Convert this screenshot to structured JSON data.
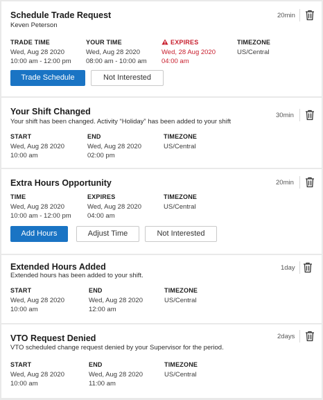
{
  "cards": [
    {
      "title": "Schedule Trade Request",
      "subtitle": "Keven Peterson",
      "time_ago": "20min",
      "columns": [
        {
          "label": "TRADE TIME",
          "line1": "Wed, Aug 28 2020",
          "line2": "10:00 am - 12:00 pm"
        },
        {
          "label": "YOUR TIME",
          "line1": "Wed, Aug 28 2020",
          "line2": "08:00 am - 10:00 am"
        },
        {
          "label": "EXPIRES",
          "line1": "Wed, 28 Aug 2020",
          "line2": "04:00 am"
        },
        {
          "label": "TIMEZONE",
          "line1": "US/Central",
          "line2": ""
        }
      ],
      "buttons": [
        "Trade Schedule",
        "Not Interested"
      ]
    },
    {
      "title": "Your Shift Changed",
      "subtitle": "Your shift has been changed. Activity “Holiday” has been added to your shift",
      "time_ago": "30min",
      "columns": [
        {
          "label": "START",
          "line1": "Wed, Aug 28 2020",
          "line2": "10:00 am"
        },
        {
          "label": "END",
          "line1": "Wed, Aug 28 2020",
          "line2": "02:00 pm"
        },
        {
          "label": "TIMEZONE",
          "line1": "US/Central",
          "line2": ""
        }
      ]
    },
    {
      "title": "Extra Hours Opportunity",
      "time_ago": "20min",
      "columns": [
        {
          "label": "TIME",
          "line1": "Wed, Aug 28 2020",
          "line2": "10:00 am - 12:00 pm"
        },
        {
          "label": "EXPIRES",
          "line1": "Wed, Aug 28 2020",
          "line2": "04:00 am"
        },
        {
          "label": "TIMEZONE",
          "line1": "US/Central",
          "line2": ""
        }
      ],
      "buttons": [
        "Add Hours",
        "Adjust Time",
        "Not Interested"
      ]
    },
    {
      "title": "Extended Hours Added",
      "subtitle": "Extended hours has been added to your shift.",
      "time_ago": "1day",
      "columns": [
        {
          "label": "START",
          "line1": "Wed, Aug 28 2020",
          "line2": "10:00 am"
        },
        {
          "label": "END",
          "line1": "Wed, Aug 28 2020",
          "line2": "12:00 am"
        },
        {
          "label": "TIMEZONE",
          "line1": "US/Central",
          "line2": ""
        }
      ]
    },
    {
      "title": "VTO Request Denied",
      "subtitle": "VTO scheduled change request denied by your Supervisor for the period.",
      "time_ago": "2days",
      "columns": [
        {
          "label": "START",
          "line1": "Wed, Aug 28 2020",
          "line2": "10:00 am"
        },
        {
          "label": "END",
          "line1": "Wed, Aug 28 2020",
          "line2": "11:00 am"
        },
        {
          "label": "TIMEZONE",
          "line1": "US/Central",
          "line2": ""
        }
      ]
    }
  ],
  "colors": {
    "primary_button": "#1a74c4",
    "expires_red": "#c8202f",
    "background": "#e9e9e9"
  },
  "icons": {
    "delete": "trash-icon",
    "warning": "warning-triangle-icon"
  }
}
